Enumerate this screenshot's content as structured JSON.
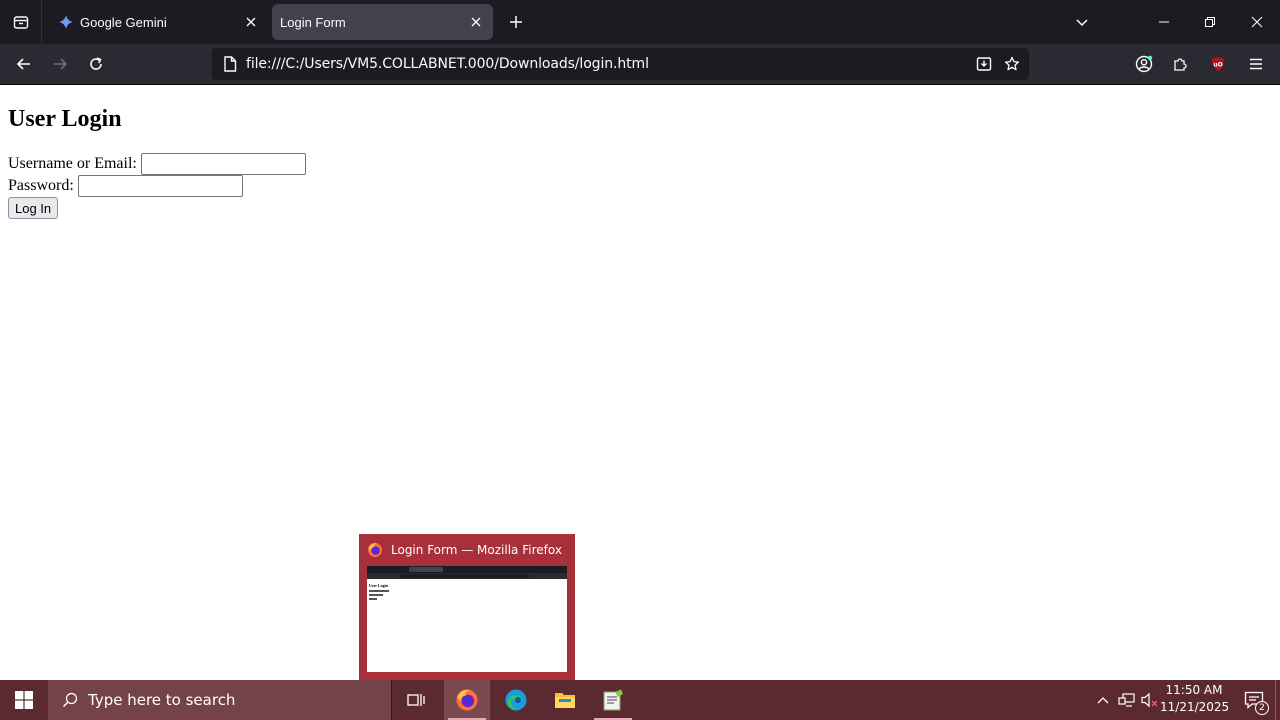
{
  "browser": {
    "tabs": [
      {
        "title": "Google Gemini",
        "icon": "gemini-icon",
        "active": false
      },
      {
        "title": "Login Form",
        "icon": "none",
        "active": true
      }
    ],
    "url": "file:///C:/Users/VM5.COLLABNET.000/Downloads/login.html"
  },
  "page": {
    "heading": "User Login",
    "username_label": "Username or Email:",
    "username_value": "",
    "password_label": "Password:",
    "password_value": "",
    "login_button": "Log In"
  },
  "preview": {
    "title": "Login Form — Mozilla Firefox",
    "thumb_heading": "User Login"
  },
  "taskbar": {
    "search_placeholder": "Type here to search",
    "time": "11:50 AM",
    "date": "11/21/2025",
    "notification_count": "2",
    "accent_color": "#5b2a31"
  }
}
